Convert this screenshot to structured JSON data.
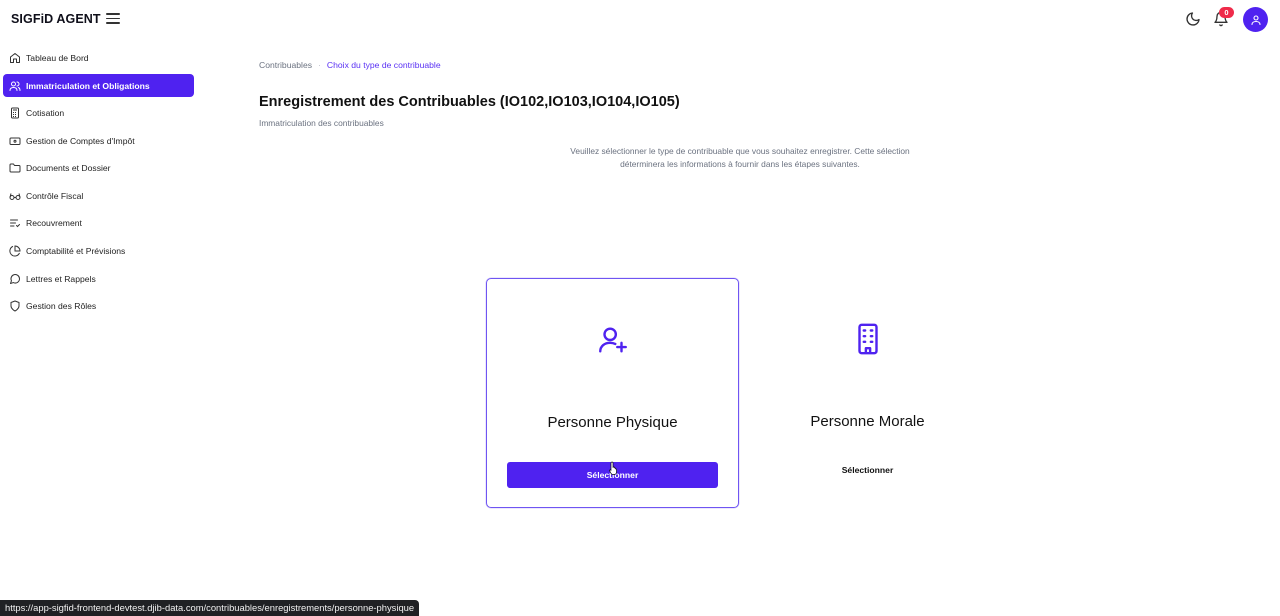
{
  "header": {
    "brand": "SIGFiD AGENT",
    "notifications_count": "0"
  },
  "sidebar": {
    "items": [
      {
        "label": "Tableau de Bord",
        "icon": "home-icon"
      },
      {
        "label": "Immatriculation et Obligations",
        "icon": "users-icon",
        "active": true
      },
      {
        "label": "Cotisation",
        "icon": "calculator-icon"
      },
      {
        "label": "Gestion de Comptes d'Impôt",
        "icon": "wallet-icon"
      },
      {
        "label": "Documents et Dossier",
        "icon": "folder-icon"
      },
      {
        "label": "Contrôle Fiscal",
        "icon": "glasses-icon"
      },
      {
        "label": "Recouvrement",
        "icon": "list-check-icon"
      },
      {
        "label": "Comptabilité et Prévisions",
        "icon": "pie-chart-icon"
      },
      {
        "label": "Lettres et Rappels",
        "icon": "message-icon"
      },
      {
        "label": "Gestion des Rôles",
        "icon": "shield-icon"
      }
    ]
  },
  "breadcrumb": {
    "items": [
      "Contribuables",
      "Choix du type de contribuable"
    ]
  },
  "main": {
    "title": "Enregistrement des Contribuables (IO102,IO103,IO104,IO105)",
    "subtitle": "Immatriculation des contribuables",
    "intro": "Veuillez sélectionner le type de contribuable que vous souhaitez enregistrer. Cette sélection déterminera les informations à fournir dans les étapes suivantes.",
    "cards": [
      {
        "title": "Personne Physique",
        "button": "Sélectionner",
        "icon": "user-plus-icon",
        "selected": true
      },
      {
        "title": "Personne Morale",
        "button": "Sélectionner",
        "icon": "building-icon",
        "selected": false
      }
    ]
  },
  "statusbar": {
    "url": "https://app-sigfid-frontend-devtest.djib-data.com/contribuables/enregistrements/personne-physique"
  },
  "colors": {
    "accent": "#4f22f0",
    "badge": "#ef2b4a"
  }
}
